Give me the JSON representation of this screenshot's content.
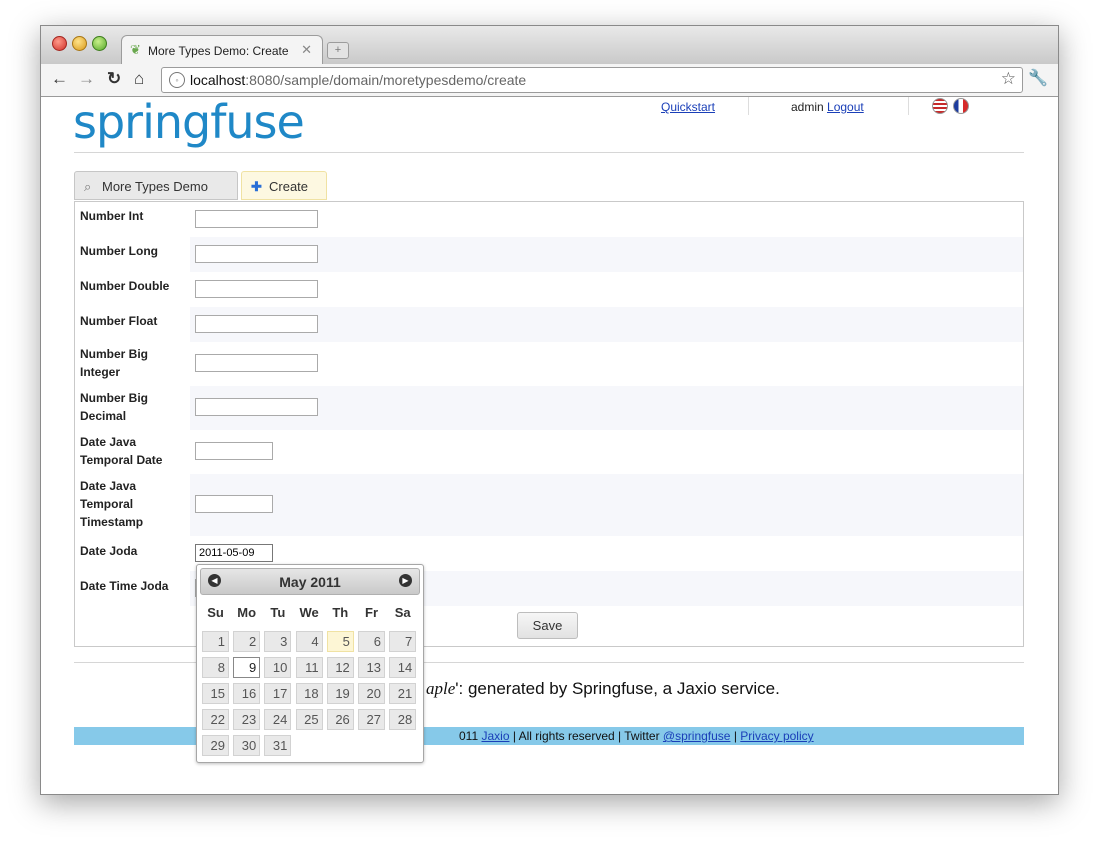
{
  "browser": {
    "tab_title": "More Types Demo: Create",
    "url_host": "localhost",
    "url_rest": ":8080/sample/domain/moretypesdemo/create"
  },
  "header": {
    "logo": "springfuse",
    "quickstart": "Quickstart",
    "user": "admin",
    "logout": "Logout"
  },
  "nav": {
    "list_tab": "More Types Demo",
    "create_tab": "Create"
  },
  "form": {
    "fields": [
      {
        "label": "Number Int",
        "value": ""
      },
      {
        "label": "Number Long",
        "value": ""
      },
      {
        "label": "Number Double",
        "value": ""
      },
      {
        "label": "Number Float",
        "value": ""
      },
      {
        "label": "Number Big Integer",
        "value": ""
      },
      {
        "label": "Number Big Decimal",
        "value": ""
      },
      {
        "label": "Date Java Temporal Date",
        "value": ""
      },
      {
        "label": "Date Java Temporal Timestamp",
        "value": ""
      },
      {
        "label": "Date Joda",
        "value": "2011-05-09"
      },
      {
        "label": "Date Time Joda",
        "value": ""
      }
    ],
    "save_label": "Save"
  },
  "calendar": {
    "month_title": "May 2011",
    "weekdays": [
      "Su",
      "Mo",
      "Tu",
      "We",
      "Th",
      "Fr",
      "Sa"
    ],
    "days": [
      "1",
      "2",
      "3",
      "4",
      "5",
      "6",
      "7",
      "8",
      "9",
      "10",
      "11",
      "12",
      "13",
      "14",
      "15",
      "16",
      "17",
      "18",
      "19",
      "20",
      "21",
      "22",
      "23",
      "24",
      "25",
      "26",
      "27",
      "28",
      "29",
      "30",
      "31"
    ],
    "today": "5",
    "selected": "9"
  },
  "footer": {
    "tagline_italic": "aple",
    "tagline_rest": "': generated by Springfuse, a Jaxio service.",
    "copyright_prefix": "011",
    "jaxio": "Jaxio",
    "rights": "| All rights reserved | Twitter",
    "twitter": "@springfuse",
    "privacy": "Privacy policy"
  }
}
